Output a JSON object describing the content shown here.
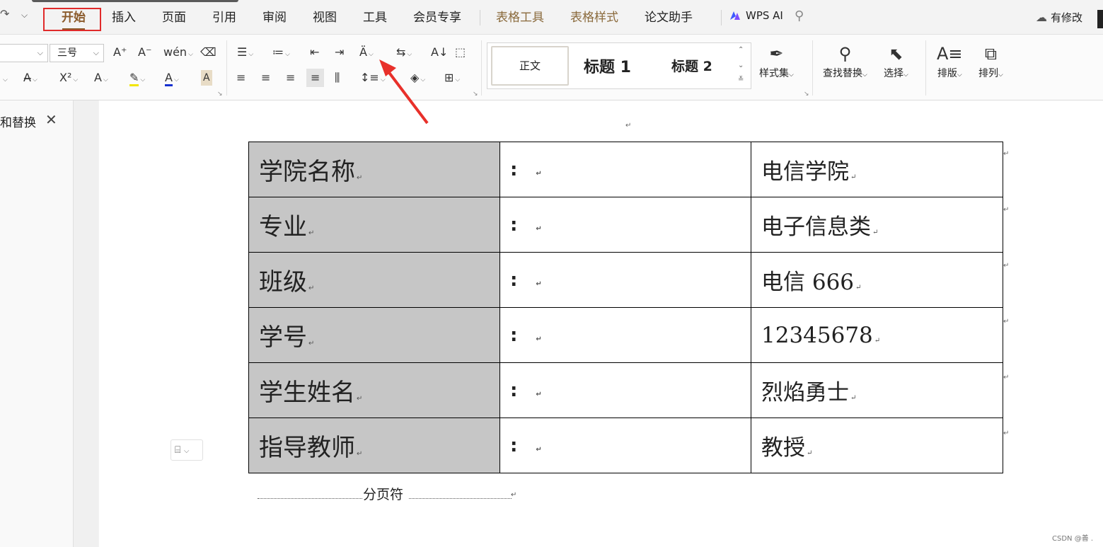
{
  "menu": {
    "tabs": [
      {
        "label": "开始",
        "active": true
      },
      {
        "label": "插入"
      },
      {
        "label": "页面"
      },
      {
        "label": "引用"
      },
      {
        "label": "审阅"
      },
      {
        "label": "视图"
      },
      {
        "label": "工具"
      },
      {
        "label": "会员专享"
      }
    ],
    "context_tabs": [
      "表格工具",
      "表格样式"
    ],
    "extra_tab": "论文助手",
    "ai_label": "WPS AI",
    "status": "有修改",
    "active_color": "#8a5a2a",
    "highlight_color": "#e02a2a"
  },
  "ribbon": {
    "font_size_value": "三号",
    "styles": {
      "normal": "正文",
      "heading1": "标题 1",
      "heading2": "标题 2"
    },
    "style_set_label": "样式集",
    "find_replace_label": "查找替换",
    "select_label": "选择",
    "layout_label": "排版",
    "arrange_label": "排列"
  },
  "left_panel": {
    "title": "和替换"
  },
  "table": {
    "rows": [
      {
        "label": "学院名称",
        "colon": ":",
        "value": "电信学院"
      },
      {
        "label": "专业",
        "colon": ":",
        "value": "电子信息类"
      },
      {
        "label": "班级",
        "colon": ":",
        "value": "电信 666"
      },
      {
        "label": "学号",
        "colon": ":",
        "value": "12345678"
      },
      {
        "label": "学生姓名",
        "colon": ":",
        "value": "烈焰勇士"
      },
      {
        "label": "指导教师",
        "colon": ":",
        "value": "教授"
      }
    ],
    "label_bg": "#c6c6c6"
  },
  "page_break_label": "分页符",
  "watermark": "CSDN @善 ."
}
